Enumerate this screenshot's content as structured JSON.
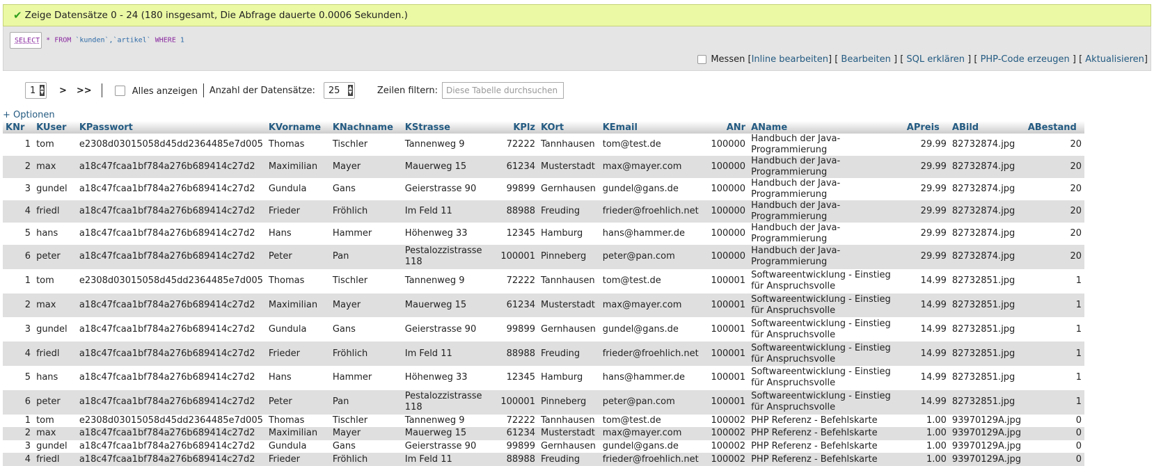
{
  "message": "Zeige Datensätze 0 - 24 (180 insgesamt, Die Abfrage dauerte 0.0006 Sekunden.)",
  "sql": {
    "select": "SELECT",
    "star": "*",
    "from": "FROM",
    "tables": "`kunden`,`artikel`",
    "where": "WHERE",
    "cond": "1"
  },
  "actions": {
    "measure": "Messen",
    "inline_edit": "Inline bearbeiten",
    "edit": "Bearbeiten",
    "explain": "SQL erklären",
    "php_code": "PHP-Code erzeugen",
    "refresh": "Aktualisieren"
  },
  "nav": {
    "page": "1",
    "next": ">",
    "last": ">>",
    "show_all": "Alles anzeigen",
    "rows_label": "Anzahl der Datensätze:",
    "rows_value": "25",
    "filter_label": "Zeilen filtern:",
    "filter_placeholder": "Diese Tabelle durchsuchen"
  },
  "options_link": "+ Optionen",
  "columns": [
    "KNr",
    "KUser",
    "KPasswort",
    "KVorname",
    "KNachname",
    "KStrasse",
    "KPlz",
    "KOrt",
    "KEmail",
    "ANr",
    "AName",
    "APreis",
    "ABild",
    "ABestand"
  ],
  "rows": [
    [
      "1",
      "tom",
      "e2308d03015058d45dd2364485e7d005",
      "Thomas",
      "Tischler",
      "Tannenweg 9",
      "72222",
      "Tannhausen",
      "tom@test.de",
      "100000",
      "Handbuch der Java-Programmierung",
      "29.99",
      "82732874.jpg",
      "20"
    ],
    [
      "2",
      "max",
      "a18c47fcaa1bf784a276b689414c27d2",
      "Maximilian",
      "Mayer",
      "Mauerweg 15",
      "61234",
      "Musterstadt",
      "max@mayer.com",
      "100000",
      "Handbuch der Java-Programmierung",
      "29.99",
      "82732874.jpg",
      "20"
    ],
    [
      "3",
      "gundel",
      "a18c47fcaa1bf784a276b689414c27d2",
      "Gundula",
      "Gans",
      "Geierstrasse 90",
      "99899",
      "Gernhausen",
      "gundel@gans.de",
      "100000",
      "Handbuch der Java-Programmierung",
      "29.99",
      "82732874.jpg",
      "20"
    ],
    [
      "4",
      "friedl",
      "a18c47fcaa1bf784a276b689414c27d2",
      "Frieder",
      "Fröhlich",
      "Im Feld 11",
      "88988",
      "Freuding",
      "frieder@froehlich.net",
      "100000",
      "Handbuch der Java-Programmierung",
      "29.99",
      "82732874.jpg",
      "20"
    ],
    [
      "5",
      "hans",
      "a18c47fcaa1bf784a276b689414c27d2",
      "Hans",
      "Hammer",
      "Höhenweg 33",
      "12345",
      "Hamburg",
      "hans@hammer.de",
      "100000",
      "Handbuch der Java-Programmierung",
      "29.99",
      "82732874.jpg",
      "20"
    ],
    [
      "6",
      "peter",
      "a18c47fcaa1bf784a276b689414c27d2",
      "Peter",
      "Pan",
      "Pestalozzistrasse 118",
      "100001",
      "Pinneberg",
      "peter@pan.com",
      "100000",
      "Handbuch der Java-Programmierung",
      "29.99",
      "82732874.jpg",
      "20"
    ],
    [
      "1",
      "tom",
      "e2308d03015058d45dd2364485e7d005",
      "Thomas",
      "Tischler",
      "Tannenweg 9",
      "72222",
      "Tannhausen",
      "tom@test.de",
      "100001",
      "Softwareentwicklung - Einstieg für Anspruchsvolle",
      "14.99",
      "82732851.jpg",
      "1"
    ],
    [
      "2",
      "max",
      "a18c47fcaa1bf784a276b689414c27d2",
      "Maximilian",
      "Mayer",
      "Mauerweg 15",
      "61234",
      "Musterstadt",
      "max@mayer.com",
      "100001",
      "Softwareentwicklung - Einstieg für Anspruchsvolle",
      "14.99",
      "82732851.jpg",
      "1"
    ],
    [
      "3",
      "gundel",
      "a18c47fcaa1bf784a276b689414c27d2",
      "Gundula",
      "Gans",
      "Geierstrasse 90",
      "99899",
      "Gernhausen",
      "gundel@gans.de",
      "100001",
      "Softwareentwicklung - Einstieg für Anspruchsvolle",
      "14.99",
      "82732851.jpg",
      "1"
    ],
    [
      "4",
      "friedl",
      "a18c47fcaa1bf784a276b689414c27d2",
      "Frieder",
      "Fröhlich",
      "Im Feld 11",
      "88988",
      "Freuding",
      "frieder@froehlich.net",
      "100001",
      "Softwareentwicklung - Einstieg für Anspruchsvolle",
      "14.99",
      "82732851.jpg",
      "1"
    ],
    [
      "5",
      "hans",
      "a18c47fcaa1bf784a276b689414c27d2",
      "Hans",
      "Hammer",
      "Höhenweg 33",
      "12345",
      "Hamburg",
      "hans@hammer.de",
      "100001",
      "Softwareentwicklung - Einstieg für Anspruchsvolle",
      "14.99",
      "82732851.jpg",
      "1"
    ],
    [
      "6",
      "peter",
      "a18c47fcaa1bf784a276b689414c27d2",
      "Peter",
      "Pan",
      "Pestalozzistrasse 118",
      "100001",
      "Pinneberg",
      "peter@pan.com",
      "100001",
      "Softwareentwicklung - Einstieg für Anspruchsvolle",
      "14.99",
      "82732851.jpg",
      "1"
    ],
    [
      "1",
      "tom",
      "e2308d03015058d45dd2364485e7d005",
      "Thomas",
      "Tischler",
      "Tannenweg 9",
      "72222",
      "Tannhausen",
      "tom@test.de",
      "100002",
      "PHP Referenz - Befehlskarte",
      "1.00",
      "93970129A.jpg",
      "0"
    ],
    [
      "2",
      "max",
      "a18c47fcaa1bf784a276b689414c27d2",
      "Maximilian",
      "Mayer",
      "Mauerweg 15",
      "61234",
      "Musterstadt",
      "max@mayer.com",
      "100002",
      "PHP Referenz - Befehlskarte",
      "1.00",
      "93970129A.jpg",
      "0"
    ],
    [
      "3",
      "gundel",
      "a18c47fcaa1bf784a276b689414c27d2",
      "Gundula",
      "Gans",
      "Geierstrasse 90",
      "99899",
      "Gernhausen",
      "gundel@gans.de",
      "100002",
      "PHP Referenz - Befehlskarte",
      "1.00",
      "93970129A.jpg",
      "0"
    ],
    [
      "4",
      "friedl",
      "a18c47fcaa1bf784a276b689414c27d2",
      "Frieder",
      "Fröhlich",
      "Im Feld 11",
      "88988",
      "Freuding",
      "frieder@froehlich.net",
      "100002",
      "PHP Referenz - Befehlskarte",
      "1.00",
      "93970129A.jpg",
      "0"
    ]
  ]
}
